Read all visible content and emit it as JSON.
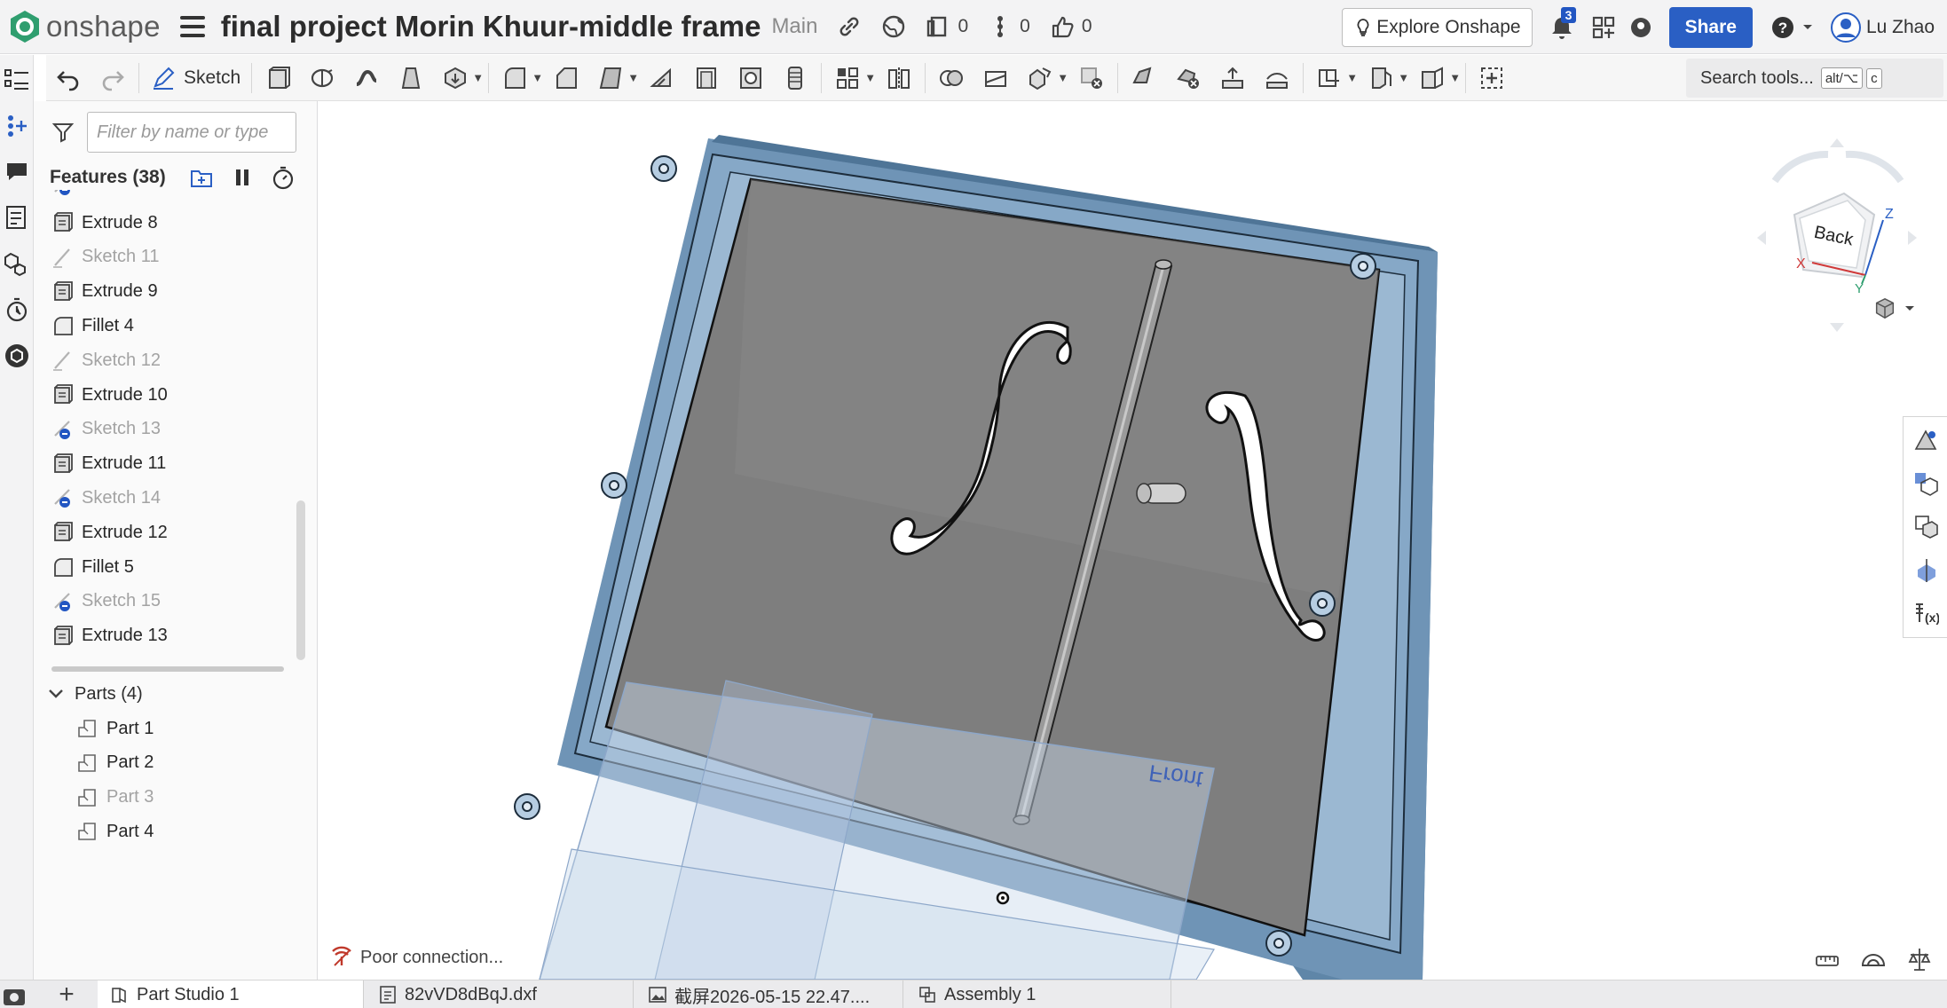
{
  "header": {
    "app_name": "onshape",
    "doc_title": "final project Morin Khuur-middle frame",
    "branch": "Main",
    "versions_count": "0",
    "branches_count": "0",
    "likes_count": "0",
    "explore_label": "Explore Onshape",
    "notifications_count": "3",
    "share_label": "Share",
    "user_name": "Lu Zhao"
  },
  "toolbar": {
    "sketch_label": "Sketch",
    "search_label": "Search tools...",
    "search_shortcut": "alt/⌥",
    "search_key": "c"
  },
  "panel": {
    "filter_placeholder": "Filter by name or type",
    "features_header": "Features (38)",
    "features": [
      {
        "label": "Extrude 8",
        "type": "extrude",
        "muted": false
      },
      {
        "label": "Sketch 11",
        "type": "sketch",
        "muted": true
      },
      {
        "label": "Extrude 9",
        "type": "extrude",
        "muted": false
      },
      {
        "label": "Fillet 4",
        "type": "fillet",
        "muted": false
      },
      {
        "label": "Sketch 12",
        "type": "sketch",
        "muted": true
      },
      {
        "label": "Extrude 10",
        "type": "extrude",
        "muted": false
      },
      {
        "label": "Sketch 13",
        "type": "sketch-hidden",
        "muted": true
      },
      {
        "label": "Extrude 11",
        "type": "extrude",
        "muted": false
      },
      {
        "label": "Sketch 14",
        "type": "sketch-hidden",
        "muted": true
      },
      {
        "label": "Extrude 12",
        "type": "extrude",
        "muted": false
      },
      {
        "label": "Fillet 5",
        "type": "fillet",
        "muted": false
      },
      {
        "label": "Sketch 15",
        "type": "sketch-hidden",
        "muted": true
      },
      {
        "label": "Extrude 13",
        "type": "extrude",
        "muted": false
      }
    ],
    "parts_header": "Parts (4)",
    "parts": [
      {
        "label": "Part 1",
        "muted": false
      },
      {
        "label": "Part 2",
        "muted": false
      },
      {
        "label": "Part 3",
        "muted": true
      },
      {
        "label": "Part 4",
        "muted": false
      }
    ]
  },
  "viewport": {
    "status_text": "Poor connection...",
    "viewcube_face": "Back",
    "plane_label": "Front",
    "axis_labels": {
      "x": "X",
      "y": "Y",
      "z": "Z"
    }
  },
  "tabs": [
    {
      "label": "Part Studio 1",
      "icon": "part-studio-icon",
      "active": true
    },
    {
      "label": "82vVD8dBqJ.dxf",
      "icon": "dxf-file-icon",
      "active": false
    },
    {
      "label": "截屏2026-05-15 22.47....",
      "icon": "image-file-icon",
      "active": false
    },
    {
      "label": "Assembly 1",
      "icon": "assembly-icon",
      "active": false
    }
  ],
  "colors": {
    "share_button": "#2a5fc4",
    "frame_blue": "#7b9fc0",
    "panel_gray": "#7d7d7d",
    "badge_blue": "#2256c2"
  }
}
